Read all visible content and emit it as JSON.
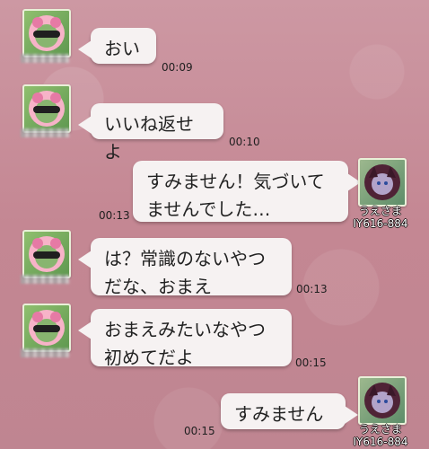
{
  "messages": [
    {
      "text": "おい",
      "time": "00:09"
    },
    {
      "text": "いいね返せよ",
      "time": "00:10"
    },
    {
      "text": "すみません！気づいてませんでした…",
      "time": "00:13"
    },
    {
      "text": "は？常識のないやつだな、おまえ",
      "time": "00:13"
    },
    {
      "text": "おまえみたいなやつ初めてだよ",
      "time": "00:15"
    },
    {
      "text": "すみません",
      "time": "00:15"
    }
  ],
  "self_user": {
    "name": "うえさま",
    "id": "IY616-884"
  },
  "colors": {
    "background": "#c98f9b",
    "bubble": "#f6f2f2",
    "avatar_frame": "#e9f0d8"
  }
}
